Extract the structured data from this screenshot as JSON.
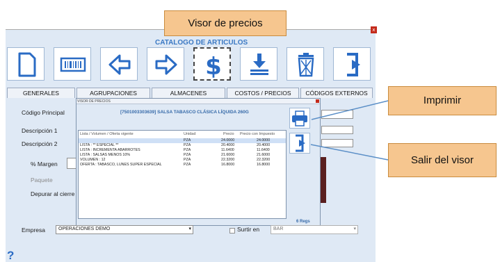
{
  "window": {
    "title": "CATALOGO DE ARTICULOS",
    "close_glyph": "x"
  },
  "toolbar": {
    "buttons": [
      {
        "name": "new",
        "icon": "document-icon"
      },
      {
        "name": "barcode",
        "icon": "barcode-icon"
      },
      {
        "name": "previous",
        "icon": "arrow-left-icon"
      },
      {
        "name": "next",
        "icon": "arrow-right-icon"
      },
      {
        "name": "price-viewer",
        "icon": "dollar-icon"
      },
      {
        "name": "save",
        "icon": "download-icon"
      },
      {
        "name": "delete",
        "icon": "trash-icon"
      },
      {
        "name": "exit",
        "icon": "exit-icon"
      }
    ]
  },
  "tabs": [
    "GENERALES",
    "AGRUPACIONES",
    "ALMACENES",
    "COSTOS / PRECIOS",
    "CÓDIGOS EXTERNOS"
  ],
  "form": {
    "codigo_principal_label": "Código Principal",
    "descripcion1_label": "Descripción 1",
    "descripcion2_label": "Descripción 2",
    "margen_label": "% Margen",
    "paquete_label": "Paquete",
    "depurar_label": "Depurar al cierre",
    "empresa_label": "Empresa",
    "empresa_value": "OPERACIONES DEMO",
    "surtir_label": "Surtir en",
    "surtir_value": "BAR"
  },
  "price_viewer": {
    "title": "VISOR DE PRECIOS",
    "product": "[7501003303639] SALSA TABASCO CLÁSICA LÍQUIDA 260G",
    "columns": [
      "Lista / Volumen / Oferta vigente",
      "Unidad",
      "Precio",
      "Precio con Impuesto"
    ],
    "rows": [
      {
        "name": "",
        "unit": "PZA",
        "price": "24.0000",
        "price_tax": "24.0000"
      },
      {
        "name": "LISTA : ** ESPECIAL **",
        "unit": "PZA",
        "price": "20.4000",
        "price_tax": "20.4000"
      },
      {
        "name": "LISTA : INCREMENTA ABARROTES",
        "unit": "PZA",
        "price": "11.6400",
        "price_tax": "11.6400"
      },
      {
        "name": "LISTA : SALSAS MENOS 10%",
        "unit": "PZA",
        "price": "21.6000",
        "price_tax": "21.6000"
      },
      {
        "name": "VOLUMEN : 12",
        "unit": "PZA",
        "price": "22.3200",
        "price_tax": "22.3200"
      },
      {
        "name": "OFERTA : TABASCO, LUNES SUPER ESPECIAL",
        "unit": "PZA",
        "price": "16.8000",
        "price_tax": "16.8000"
      }
    ],
    "regs": "6  Regs"
  },
  "callouts": {
    "visor": "Visor de precios",
    "imprimir": "Imprimir",
    "salir": "Salir del visor"
  },
  "help": "?",
  "colors": {
    "accent": "#2a6bc4",
    "window_bg": "#dfe9f5",
    "callout_bg": "#f6c68f",
    "close_red": "#c42b1c"
  }
}
